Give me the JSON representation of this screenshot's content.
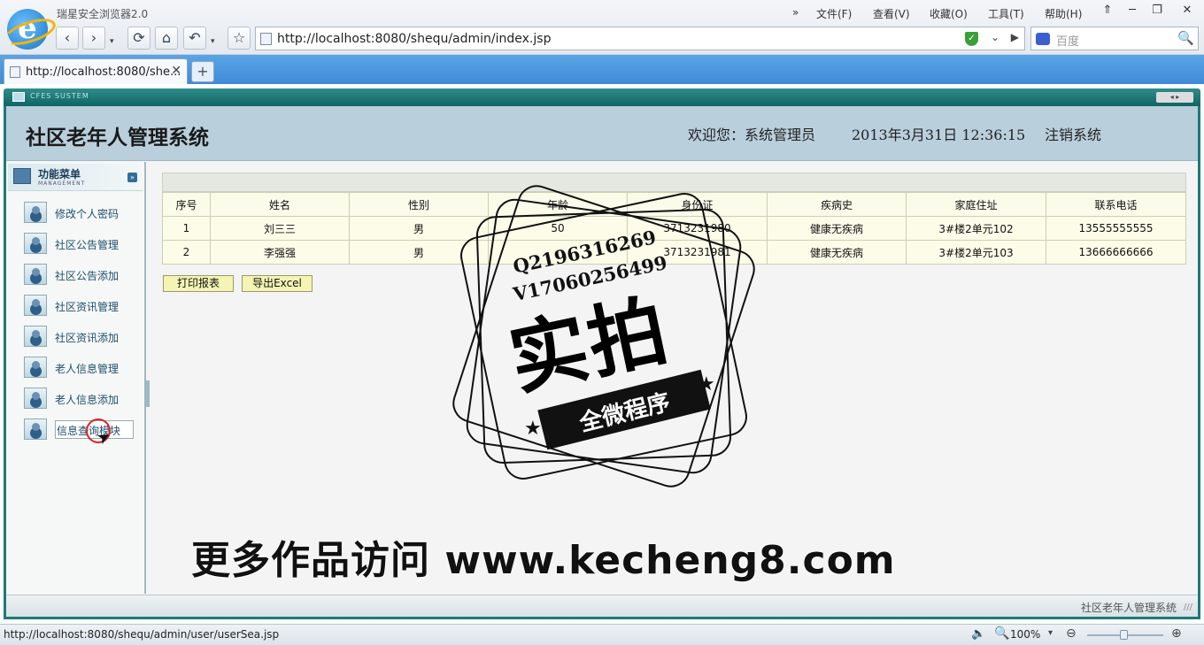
{
  "browser": {
    "app_title": "瑞星安全浏览器2.0",
    "overflow": "»",
    "menus": [
      "文件(F)",
      "查看(V)",
      "收藏(O)",
      "工具(T)",
      "帮助(H)"
    ],
    "window_buttons": [
      "⇑",
      "─",
      "❐",
      "✕"
    ],
    "nav": {
      "back": "‹",
      "forward": "›",
      "forward_drop": "▾",
      "refresh": "⟳",
      "home": "⌂",
      "undo": "↶",
      "undo_drop": "▾",
      "favorite": "☆"
    },
    "address": "http://localhost:8080/shequ/admin/index.jsp",
    "address_drop": "⌄",
    "address_go": "▶",
    "search_placeholder": "百度",
    "search_button": "🔍",
    "tab_label": "http://localhost:8080/she...",
    "tab_close": "✕",
    "new_tab": "+",
    "shield": "✓"
  },
  "frame": {
    "bar_label": "CFES SUSTEM",
    "bar_nav": "◂ ▸"
  },
  "header": {
    "title": "社区老年人管理系统",
    "welcome": "欢迎您：系统管理员",
    "datetime": "2013年3月31日  12:36:15",
    "logout": "注销系统"
  },
  "sidebar": {
    "title": "功能菜单",
    "subtitle": "MANAGEMENT",
    "collapse": "»",
    "items": [
      {
        "label": "修改个人密码"
      },
      {
        "label": "社区公告管理"
      },
      {
        "label": "社区公告添加"
      },
      {
        "label": "社区资讯管理"
      },
      {
        "label": "社区资讯添加"
      },
      {
        "label": "老人信息管理"
      },
      {
        "label": "老人信息添加"
      },
      {
        "label": "信息查询模块"
      }
    ]
  },
  "table": {
    "columns": [
      "序号",
      "姓名",
      "性别",
      "年龄",
      "身份证",
      "疾病史",
      "家庭住址",
      "联系电话"
    ],
    "rows": [
      [
        "1",
        "刘三三",
        "男",
        "50",
        "3713231980",
        "健康无疾病",
        "3#楼2单元102",
        "13555555555"
      ],
      [
        "2",
        "李强强",
        "男",
        "",
        "3713231981",
        "健康无疾病",
        "3#楼2单元103",
        "13666666666"
      ]
    ]
  },
  "buttons": {
    "print": "打印报表",
    "export": "导出Excel"
  },
  "watermark": {
    "qq": "Q2196316269",
    "v": "V17060256499",
    "main": "实拍",
    "ribbon": "全微程序",
    "star": "★",
    "site": "更多作品访问 www.kecheng8.com"
  },
  "footer": {
    "text": "社区老年人管理系统",
    "grip": "///"
  },
  "status": {
    "url": "http://localhost:8080/shequ/admin/user/userSea.jsp",
    "speaker": "🔈",
    "zoom_icon": "🔍",
    "zoom": "100%",
    "zoom_drop": "▾",
    "minus": "⊖",
    "plus": "⊕"
  }
}
